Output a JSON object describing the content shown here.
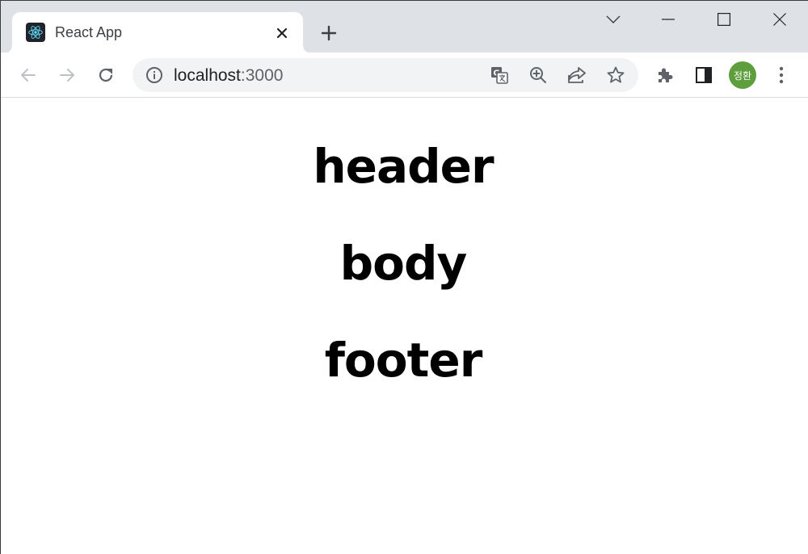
{
  "tab": {
    "title": "React App"
  },
  "toolbar": {
    "url_host": "localhost",
    "url_port": ":3000",
    "avatar_text": "정환"
  },
  "icons": {
    "favicon": "react-logo-icon",
    "tab_close": "close-icon",
    "new_tab": "plus-icon",
    "tab_search": "chevron-down-icon",
    "minimize": "minimize-icon",
    "maximize": "maximize-icon",
    "close_window": "close-icon",
    "back": "arrow-left-icon",
    "forward": "arrow-right-icon",
    "reload": "reload-icon",
    "site_info": "info-icon",
    "translate": "translate-icon",
    "zoom": "zoom-in-icon",
    "share": "share-icon",
    "bookmark": "star-icon",
    "extensions": "puzzle-icon",
    "side_panel": "side-panel-icon",
    "menu": "kebab-menu-icon"
  },
  "colors": {
    "tabstrip": "#dee1e6",
    "omnibox": "#f1f3f4",
    "avatar": "#5e9e3c",
    "react_blue": "#61dafb"
  },
  "page": {
    "header": "header",
    "body": "body",
    "footer": "footer"
  }
}
